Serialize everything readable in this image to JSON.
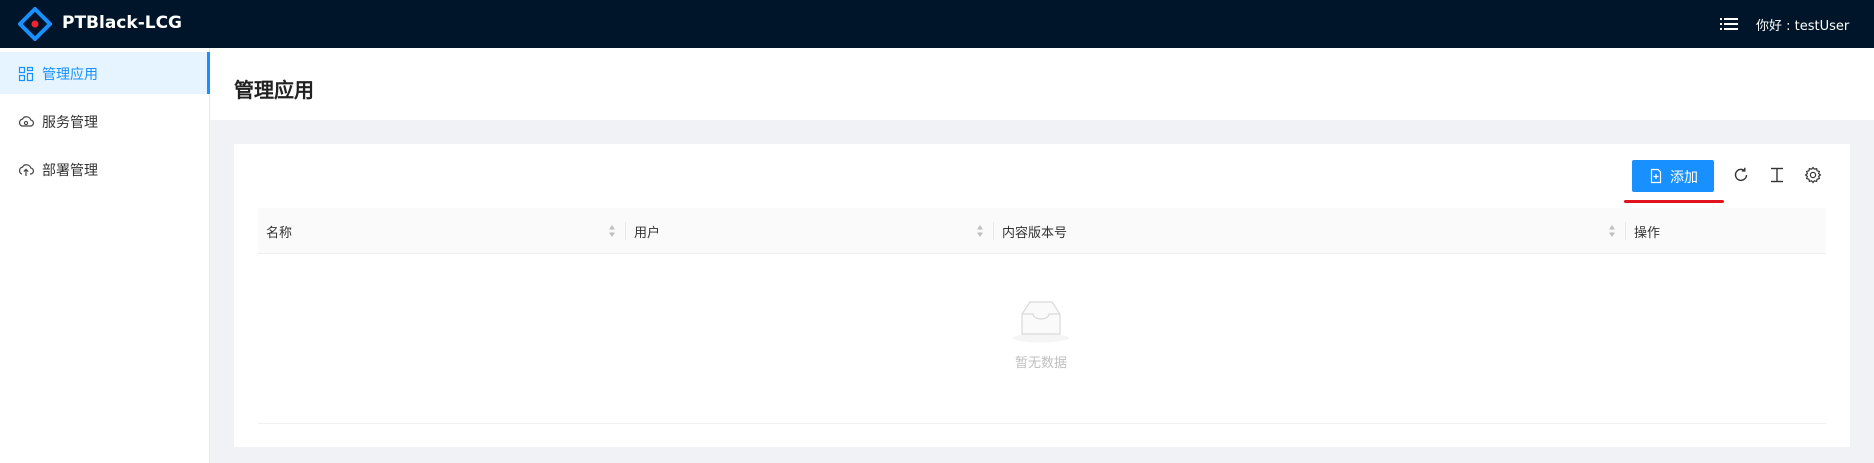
{
  "header": {
    "app_name": "PTBlack-LCG",
    "greeting": "你好 : testUser"
  },
  "sidebar": {
    "items": [
      {
        "label": "管理应用",
        "icon": "apps-icon",
        "active": true
      },
      {
        "label": "服务管理",
        "icon": "cloud-service-icon",
        "active": false
      },
      {
        "label": "部署管理",
        "icon": "cloud-upload-icon",
        "active": false
      }
    ]
  },
  "page": {
    "title": "管理应用"
  },
  "toolbar": {
    "add_label": "添加",
    "tools": [
      "reload-icon",
      "column-height-icon",
      "setting-icon"
    ]
  },
  "table": {
    "columns": [
      "名称",
      "用户",
      "内容版本号",
      "操作"
    ],
    "rows": [],
    "empty_text": "暂无数据"
  },
  "colors": {
    "topbar": "#001529",
    "accent": "#1890ff",
    "highlight": "#e0141e"
  }
}
